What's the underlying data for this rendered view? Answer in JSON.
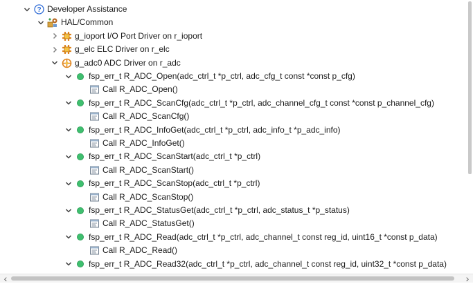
{
  "tree": {
    "rows": [
      {
        "indent": 0,
        "twisty": "expanded",
        "icon": "help-icon",
        "label": "Developer Assistance"
      },
      {
        "indent": 1,
        "twisty": "expanded",
        "icon": "hal-common-icon",
        "label": "HAL/Common"
      },
      {
        "indent": 2,
        "twisty": "collapsed",
        "icon": "driver-icon",
        "label": "g_ioport I/O Port Driver on r_ioport"
      },
      {
        "indent": 2,
        "twisty": "collapsed",
        "icon": "driver-icon",
        "label": "g_elc ELC Driver on r_elc"
      },
      {
        "indent": 2,
        "twisty": "expanded",
        "icon": "driver-active-icon",
        "label": "g_adc0 ADC Driver on r_adc"
      },
      {
        "indent": 3,
        "twisty": "expanded",
        "icon": "function-dot-icon",
        "label": "fsp_err_t R_ADC_Open(adc_ctrl_t *p_ctrl, adc_cfg_t const *const p_cfg)"
      },
      {
        "indent": 4,
        "twisty": "none",
        "icon": "code-call-icon",
        "label": "Call R_ADC_Open()"
      },
      {
        "indent": 3,
        "twisty": "expanded",
        "icon": "function-dot-icon",
        "label": "fsp_err_t R_ADC_ScanCfg(adc_ctrl_t *p_ctrl, adc_channel_cfg_t const *const p_channel_cfg)"
      },
      {
        "indent": 4,
        "twisty": "none",
        "icon": "code-call-icon",
        "label": "Call R_ADC_ScanCfg()"
      },
      {
        "indent": 3,
        "twisty": "expanded",
        "icon": "function-dot-icon",
        "label": "fsp_err_t R_ADC_InfoGet(adc_ctrl_t *p_ctrl, adc_info_t *p_adc_info)"
      },
      {
        "indent": 4,
        "twisty": "none",
        "icon": "code-call-icon",
        "label": "Call R_ADC_InfoGet()"
      },
      {
        "indent": 3,
        "twisty": "expanded",
        "icon": "function-dot-icon",
        "label": "fsp_err_t R_ADC_ScanStart(adc_ctrl_t *p_ctrl)"
      },
      {
        "indent": 4,
        "twisty": "none",
        "icon": "code-call-icon",
        "label": "Call R_ADC_ScanStart()"
      },
      {
        "indent": 3,
        "twisty": "expanded",
        "icon": "function-dot-icon",
        "label": "fsp_err_t R_ADC_ScanStop(adc_ctrl_t *p_ctrl)"
      },
      {
        "indent": 4,
        "twisty": "none",
        "icon": "code-call-icon",
        "label": "Call R_ADC_ScanStop()"
      },
      {
        "indent": 3,
        "twisty": "expanded",
        "icon": "function-dot-icon",
        "label": "fsp_err_t R_ADC_StatusGet(adc_ctrl_t *p_ctrl, adc_status_t *p_status)"
      },
      {
        "indent": 4,
        "twisty": "none",
        "icon": "code-call-icon",
        "label": "Call R_ADC_StatusGet()"
      },
      {
        "indent": 3,
        "twisty": "expanded",
        "icon": "function-dot-icon",
        "label": "fsp_err_t R_ADC_Read(adc_ctrl_t *p_ctrl, adc_channel_t const reg_id, uint16_t *const p_data)"
      },
      {
        "indent": 4,
        "twisty": "none",
        "icon": "code-call-icon",
        "label": "Call R_ADC_Read()"
      },
      {
        "indent": 3,
        "twisty": "expanded",
        "icon": "function-dot-icon",
        "label": "fsp_err_t R_ADC_Read32(adc_ctrl_t *p_ctrl, adc_channel_t const reg_id, uint32_t *const p_data)"
      }
    ]
  },
  "colors": {
    "function_dot": "#3fbf6f",
    "help_blue": "#2e6bd6",
    "driver_orange": "#e0851f"
  },
  "scrollbar": {
    "left_arrow": "‹",
    "right_arrow": "›"
  }
}
